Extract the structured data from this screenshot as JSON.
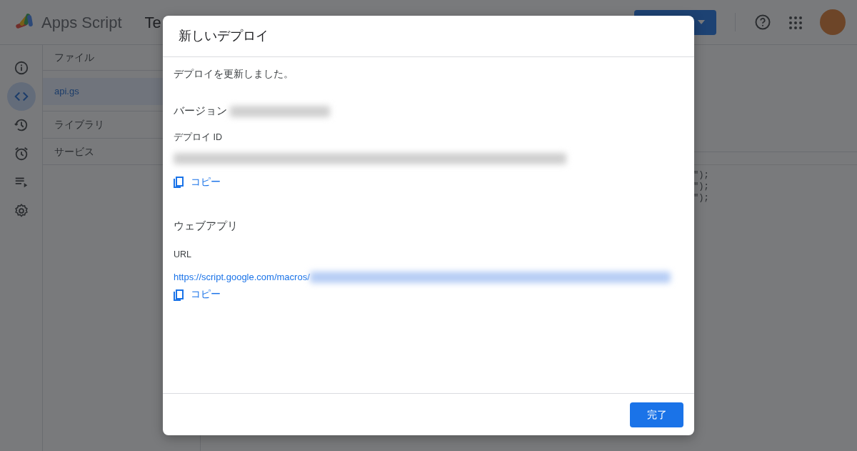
{
  "app": {
    "title": "Apps Script",
    "project_title": "Te"
  },
  "nav_rail": [
    {
      "kind": "info",
      "selected": false
    },
    {
      "kind": "code",
      "selected": true
    },
    {
      "kind": "history",
      "selected": false
    },
    {
      "kind": "alarm",
      "selected": false
    },
    {
      "kind": "runs",
      "selected": false
    },
    {
      "kind": "settings",
      "selected": false
    }
  ],
  "files_panel": {
    "header": "ファイル",
    "files": [
      {
        "name": "api.gs",
        "selected": true
      }
    ],
    "sections": [
      "ライブラリ",
      "サービス"
    ]
  },
  "editor": {
    "code_lines": [
      "\");",
      "\");",
      "\");"
    ]
  },
  "dialog": {
    "title": "新しいデプロイ",
    "message": "デプロイを更新しました。",
    "version_label": "バージョン",
    "deploy_id_label": "デプロイ ID",
    "copy_buttons": [
      "コピー",
      "コピー"
    ],
    "web_app_heading": "ウェブアプリ",
    "url_label": "URL",
    "url": "https://script.google.com/macros/",
    "done_button": "完了"
  }
}
